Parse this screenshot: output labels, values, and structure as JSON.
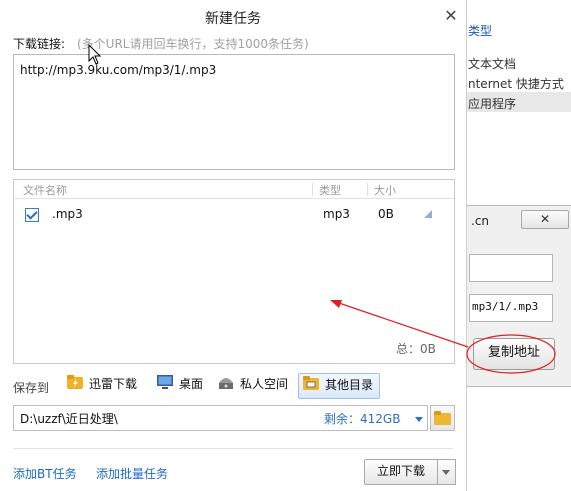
{
  "background": {
    "type_header": "类型",
    "context_items": [
      "文本文档",
      "nternet 快捷方式",
      "应用程序"
    ],
    "small_window": {
      "title": ".cn",
      "close_label": "✕",
      "field_value": "mp3/1/.mp3",
      "copy_button": "复制地址"
    }
  },
  "dialog": {
    "title": "新建任务",
    "close_label": "✕",
    "link_label": "下载链接:",
    "link_hint": "(多个URL请用回车换行，支持1000条任务)",
    "url_value": "http://mp3.9ku.com/mp3/1/.mp3",
    "columns": {
      "name": "文件名称",
      "type": "类型",
      "size": "大小"
    },
    "files": [
      {
        "name": ".mp3",
        "type": "mp3",
        "size": "0B",
        "checked": true
      }
    ],
    "total": "总：0B",
    "save_label": "保存到",
    "locations": [
      {
        "label": "迅雷下载",
        "icon": "thunder-folder-icon"
      },
      {
        "label": "桌面",
        "icon": "desktop-icon"
      },
      {
        "label": "私人空间",
        "icon": "private-space-icon"
      },
      {
        "label": "其他目录",
        "icon": "other-folder-icon",
        "selected": true
      }
    ],
    "path": "D:\\uzzf\\近日处理\\",
    "remaining": "剩余：412GB",
    "add_bt": "添加BT任务",
    "add_batch": "添加批量任务",
    "download_now": "立即下载"
  },
  "colors": {
    "link": "#1b6ac9",
    "annotation": "#e02020"
  }
}
